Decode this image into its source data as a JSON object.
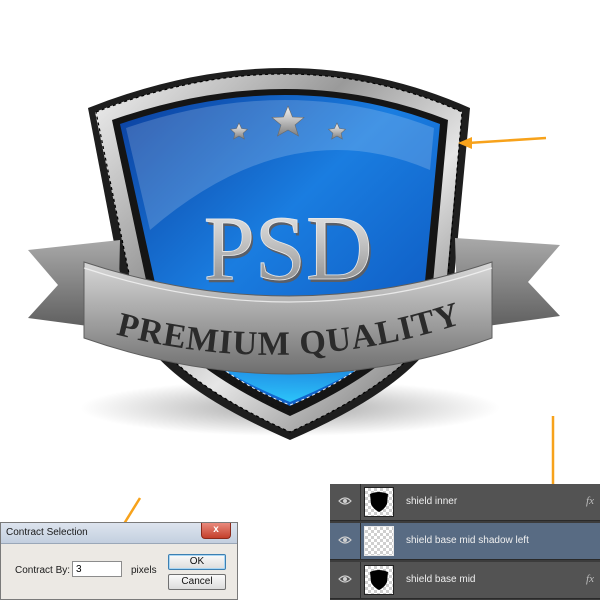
{
  "artwork": {
    "big_text": "PSD",
    "banner_text": "PREMIUM QUALITY",
    "star_count": 3,
    "shield_color": "#1a7de0",
    "arrow_color": "#f7a21b"
  },
  "dialog": {
    "title": "Contract Selection",
    "close_label": "x",
    "contract_by_label": "Contract By:",
    "contract_by_value": "3",
    "unit_label": "pixels",
    "ok_label": "OK",
    "cancel_label": "Cancel"
  },
  "layers": [
    {
      "name": "shield inner",
      "selected": false,
      "thumb": "shield-shape",
      "fx": "fx"
    },
    {
      "name": "shield base mid shadow left",
      "selected": true,
      "thumb": "empty",
      "fx": ""
    },
    {
      "name": "shield base mid",
      "selected": false,
      "thumb": "shield-shape",
      "fx": "fx"
    }
  ]
}
